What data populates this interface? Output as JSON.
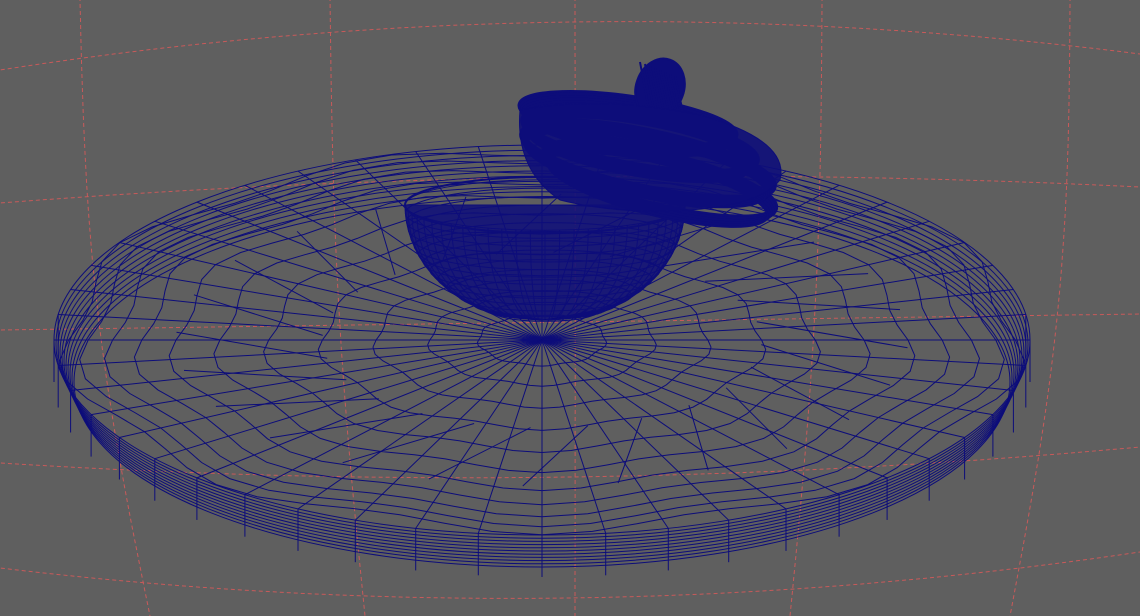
{
  "viewport": {
    "background_color": "#5f5f5f",
    "display_mode": "wireframe",
    "grid": {
      "visible": true,
      "color": "#c85a5a",
      "style": "dashed"
    },
    "wireframe_color": "#0d0d7a",
    "objects": [
      {
        "name": "plate",
        "shape": "flat-cylinder-disc"
      },
      {
        "name": "bowl",
        "shape": "hemisphere"
      },
      {
        "name": "coiled-rope",
        "shape": "torus-stack"
      }
    ]
  }
}
